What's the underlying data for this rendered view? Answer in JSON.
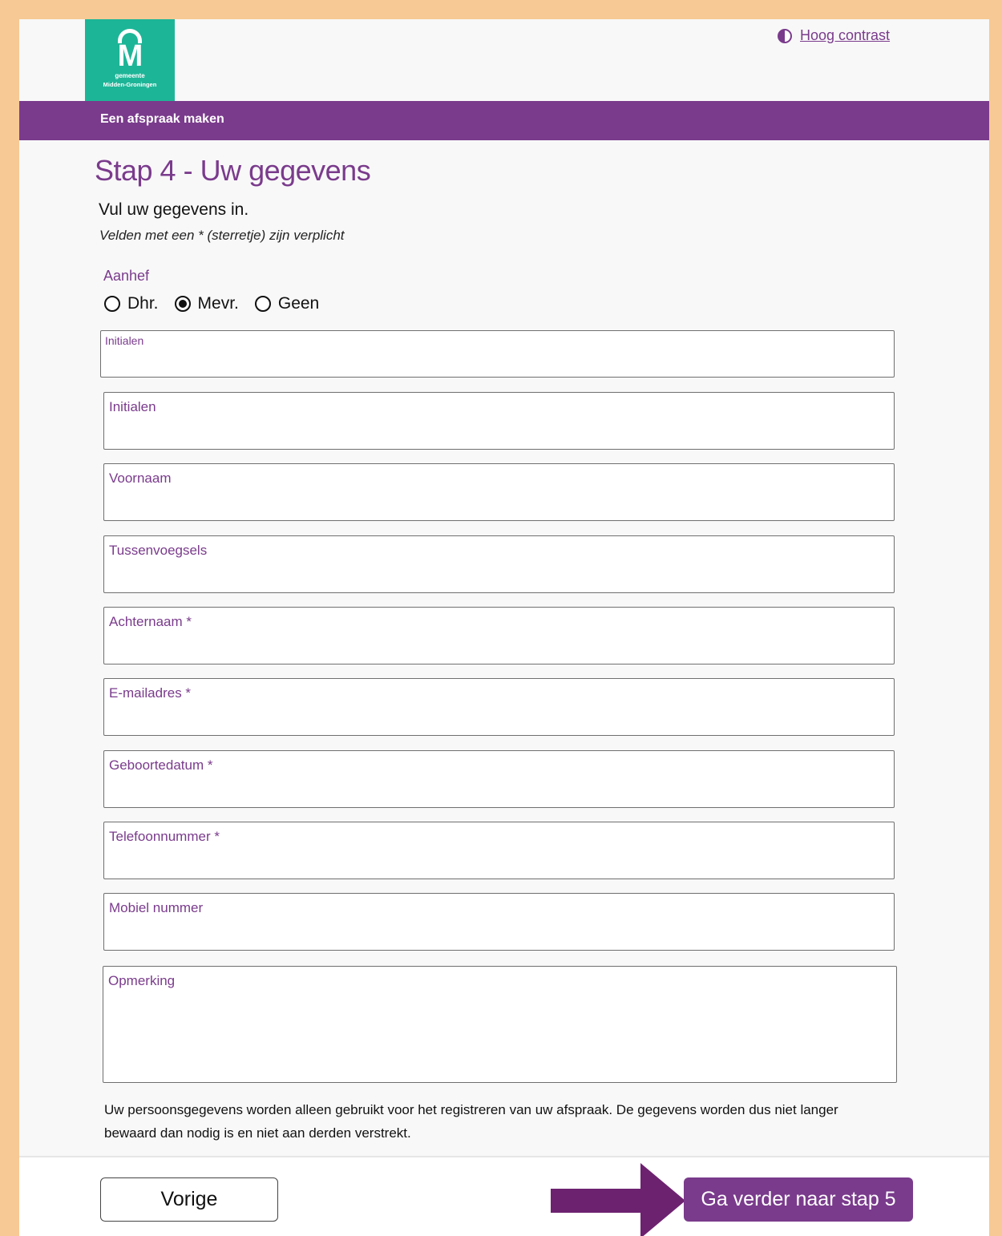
{
  "header": {
    "logo_letter": "M",
    "logo_line1": "gemeente",
    "logo_line2": "Midden-Groningen",
    "contrast_link": "Hoog contrast"
  },
  "nav": {
    "title": "Een afspraak maken"
  },
  "page": {
    "title": "Stap 4 - Uw gegevens",
    "intro": "Vul uw gegevens in.",
    "required_note": "Velden met een * (sterretje) zijn verplicht"
  },
  "salutation": {
    "label": "Aanhef",
    "options": [
      "Dhr.",
      "Mevr.",
      "Geen"
    ],
    "selected": "Mevr."
  },
  "fields": {
    "initials_small": "Initialen",
    "initials": "Initialen",
    "first_name": "Voornaam",
    "infix": "Tussenvoegsels",
    "last_name": "Achternaam *",
    "email": "E-mailadres *",
    "birthdate": "Geboortedatum *",
    "phone": "Telefoonnummer *",
    "mobile": "Mobiel nummer",
    "remark": "Opmerking"
  },
  "privacy": {
    "line1": "Uw persoonsgegevens worden alleen gebruikt voor het registreren van uw afspraak. De gegevens worden dus niet langer",
    "line2": "bewaard dan nodig is en niet aan derden verstrekt."
  },
  "footer": {
    "prev_label": "Vorige",
    "next_label": "Ga verder naar stap 5"
  },
  "colors": {
    "brand_purple": "#7a3b8c",
    "logo_green": "#1db597",
    "frame_orange": "#f7c994",
    "arrow_purple": "#6d2270"
  },
  "icons": {
    "contrast": "half-filled-circle",
    "pointer": "arrow-right"
  }
}
